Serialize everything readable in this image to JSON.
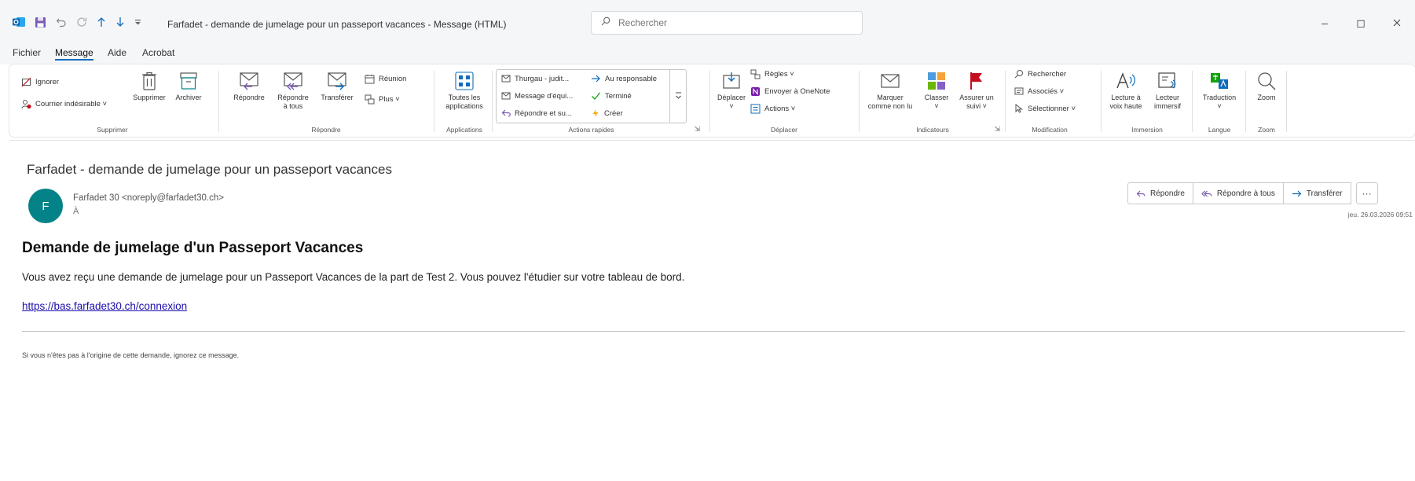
{
  "titlebar": {
    "title": "Farfadet - demande de jumelage pour un passeport vacances - Message (HTML)",
    "search_placeholder": "Rechercher",
    "minimize": "–",
    "restore": "◻"
  },
  "menu": {
    "tabs": [
      {
        "label": "Fichier"
      },
      {
        "label": "Message"
      },
      {
        "label": "Aide"
      },
      {
        "label": "Acrobat"
      }
    ],
    "active_tab": "Message"
  },
  "ribbon": {
    "supprimer": {
      "group_label": "Supprimer",
      "ignore": "Ignorer",
      "junk": "Courrier indésirable ˅",
      "delete": "Supprimer",
      "archive": "Archiver"
    },
    "repondre": {
      "group_label": "Répondre",
      "reply": "Répondre",
      "reply_all_line1": "Répondre",
      "reply_all_line2": "à tous",
      "forward": "Transférer",
      "meeting": "Réunion",
      "more": "Plus ˅"
    },
    "applications": {
      "group_label": "Applications",
      "all_apps_line1": "Toutes les",
      "all_apps_line2": "applications"
    },
    "actions_rapides": {
      "group_label": "Actions rapides",
      "items": [
        {
          "label": "Thurgau - judit..."
        },
        {
          "label": "Message d'équi..."
        },
        {
          "label": "Répondre et su..."
        },
        {
          "label": "Au responsable"
        },
        {
          "label": "Terminé"
        },
        {
          "label": "Créer"
        }
      ]
    },
    "deplacer": {
      "group_label": "Déplacer",
      "move": "Déplacer",
      "move_arrow": "˅",
      "rules": "Règles ˅",
      "onenote": "Envoyer à OneNote",
      "actions": "Actions ˅"
    },
    "indicateurs": {
      "group_label": "Indicateurs",
      "mark_unread_line1": "Marquer",
      "mark_unread_line2": "comme non lu",
      "categorize": "Classer",
      "categorize_arrow": "˅",
      "followup_line1": "Assurer un",
      "followup_line2": "suivi ˅"
    },
    "modification": {
      "group_label": "Modification",
      "find": "Rechercher",
      "related": "Associés ˅",
      "select": "Sélectionner ˅"
    },
    "immersion": {
      "group_label": "Immersion",
      "read_aloud_line1": "Lecture à",
      "read_aloud_line2": "voix haute",
      "immersive_line1": "Lecteur",
      "immersive_line2": "immersif"
    },
    "langue": {
      "group_label": "Langue",
      "translate": "Traduction",
      "translate_arrow": "˅"
    },
    "zoom": {
      "group_label": "Zoom",
      "zoom": "Zoom"
    }
  },
  "message": {
    "subject": "Farfadet - demande de jumelage pour un passeport vacances",
    "avatar_initial": "F",
    "sender": "Farfadet 30 <noreply@farfadet30.ch>",
    "recipient": "À",
    "date": "jeu. 26.03.2026 09:51",
    "actions": {
      "reply": "Répondre",
      "reply_all": "Répondre à tous",
      "forward": "Transférer",
      "more": "···"
    },
    "body": {
      "heading": "Demande de jumelage d'un Passeport Vacances",
      "text": "Vous avez reçu une demande de jumelage pour un Passeport Vacances de la part de Test 2. Vous pouvez l'étudier sur votre tableau de bord.",
      "link": "https://bas.farfadet30.ch/connexion",
      "footnote": "Si vous n'êtes pas à l'origine de cette demande, ignorez ce message."
    }
  },
  "colors": {
    "accent": "#0f6cbd",
    "avatar": "#038387",
    "flag": "#c50f1f",
    "link": "#1a0dab"
  }
}
